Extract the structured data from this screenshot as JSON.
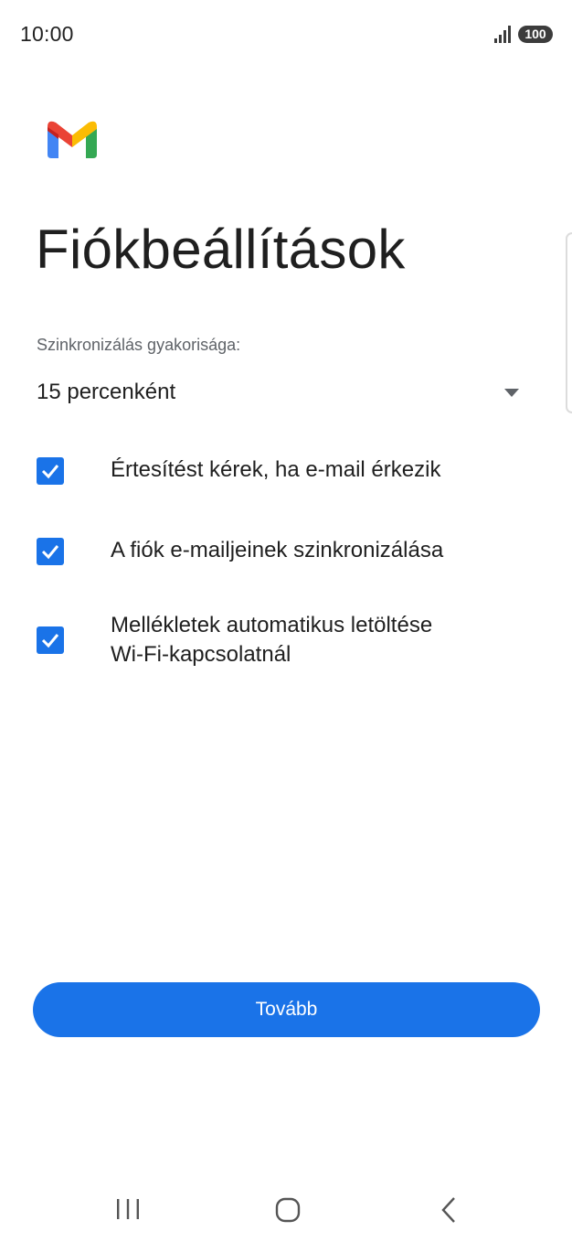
{
  "status_bar": {
    "time": "10:00",
    "battery": "100",
    "icons": [
      "signal-icon",
      "battery-icon"
    ]
  },
  "header": {
    "logo": "gmail-logo",
    "title": "Fiókbeállítások"
  },
  "sync": {
    "label": "Szinkronizálás gyakorisága:",
    "selected": "15 percenként",
    "icon": "dropdown-arrow-icon"
  },
  "options": [
    {
      "lines": [
        "Értesítést kérek, ha e-mail érkezik"
      ],
      "checked": true
    },
    {
      "lines": [
        "A fiók e-mailjeinek szinkronizálása"
      ],
      "checked": true
    },
    {
      "lines": [
        "Mellékletek automatikus letöltése",
        "Wi-Fi-kapcsolatnál"
      ],
      "checked": true
    }
  ],
  "next_button": {
    "label": "Tovább"
  },
  "nav_bar": {
    "icons": [
      "recents-icon",
      "home-icon",
      "back-icon"
    ]
  },
  "colors": {
    "accent": "#1a73e8",
    "text": "#1f1f1f",
    "secondary_text": "#5f6368",
    "gmail_red": "#ea4335",
    "gmail_blue": "#4285f4",
    "gmail_green": "#34a853",
    "gmail_yellow": "#fbbc04"
  }
}
